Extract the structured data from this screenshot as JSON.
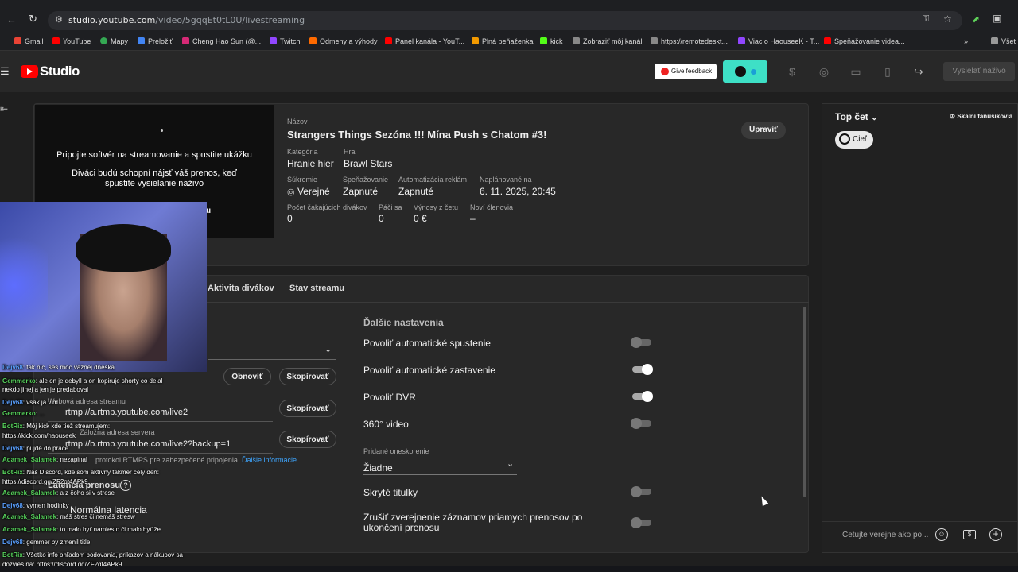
{
  "browser": {
    "url_host": "studio.youtube.com",
    "url_path": "/video/5gqqEt0tL0U/livestreaming",
    "bookmarks": [
      "Gmail",
      "YouTube",
      "Mapy",
      "Preložiť",
      "Cheng Hao Sun (@...",
      "Twitch",
      "Odmeny a výhody",
      "Panel kanála - YouT...",
      "Plná peňaženka",
      "kick",
      "Zobraziť môj kanál",
      "https://remotedeskt...",
      "Viac o HaouseeK - T...",
      "Speňažovanie videa..."
    ],
    "more": "»",
    "other": "Všet"
  },
  "header": {
    "logo": "Studio",
    "feedback": "Give feedback",
    "go_live": "Vysielať naživo"
  },
  "preview": {
    "line1": "Pripojte softvér na streamovanie a spustite ukážku",
    "line2": "Diváci budú schopní nájsť váš prenos, keď spustite vysielanie naživo",
    "partial": "u"
  },
  "stream": {
    "title_label": "Názov",
    "title": "Strangers Things Sezóna !!! Mína Push s Chatom #3!",
    "category_label": "Kategória",
    "category": "Hranie hier",
    "game_label": "Hra",
    "game": "Brawl Stars",
    "privacy_label": "Súkromie",
    "privacy": "Verejné",
    "monet_label": "Speňažovanie",
    "monet": "Zapnuté",
    "ads_label": "Automatizácia reklám",
    "ads": "Zapnuté",
    "sched_label": "Naplánované na",
    "sched": "6. 11. 2025, 20:45",
    "waiting_label": "Počet čakajúcich divákov",
    "waiting": "0",
    "likes_label": "Páči sa",
    "likes": "0",
    "chat_rev_label": "Výnosy z četu",
    "chat_rev": "0 €",
    "members_label": "Noví členovia",
    "members": "–",
    "edit": "Upraviť"
  },
  "tabs": [
    "Aktivita divákov",
    "Stav streamu"
  ],
  "left_settings": {
    "refresh": "Obnoviť",
    "copy": "Skopírovať",
    "url_label": "Webová adresa streamu",
    "url1": "rtmp://a.rtmp.youtube.com/live2",
    "backup_label": "Záložná adresa servera",
    "url2": "rtmp://b.rtmp.youtube.com/live2?backup=1",
    "rtmps": "protokol RTMPS pre zabezpečené pripojenia.",
    "more_info": "Ďalšie informácie",
    "latency_label": "Latencia prenosu",
    "latency": "Normálna latencia"
  },
  "more_settings": {
    "title": "Ďalšie nastavenia",
    "auto_start": "Povoliť automatické spustenie",
    "auto_stop": "Povoliť automatické zastavenie",
    "dvr": "Povoliť DVR",
    "video360": "360° video",
    "delay_label": "Pridané oneskorenie",
    "delay": "Žiadne",
    "captions": "Skryté titulky",
    "unlist": "Zrušiť zverejnenie záznamov priamych prenosov po ukončení prenosu"
  },
  "toggles": {
    "auto_start": 0,
    "auto_stop": 1,
    "dvr": 1,
    "video360": 0,
    "captions": 0,
    "unlist": 0
  },
  "chat": {
    "mode": "Top čet",
    "fans": "Skalní fanúšikovia",
    "goal": "Cieľ",
    "placeholder": "Četujte verejne ako po..."
  },
  "chat_overlay": [
    {
      "user": "Dejv68",
      "text": ": tak nic, ses moc vážnej dneska",
      "cls": "b"
    },
    {
      "user": "Gemmerko",
      "text": ": ale on je debyll a on kopiruje shorty co delal",
      "cls": "g"
    },
    {
      "user": "",
      "text": "nekdo jinej a jen je predaboval",
      "cls": ""
    },
    {
      "user": "Dejv68",
      "text": ": vsak ja vim",
      "cls": "b"
    },
    {
      "user": "Gemmerko",
      "text": ": ...",
      "cls": "g"
    },
    {
      "user": "BotRix",
      "text": ": Môj kick kde tiež streamujem:",
      "cls": "g"
    },
    {
      "user": "",
      "text": "https://kick.com/haouseek",
      "cls": ""
    },
    {
      "user": "Dejv68",
      "text": ": pujde do prace",
      "cls": "b"
    },
    {
      "user": "Adamek_Salamek",
      "text": ": nezapinal",
      "cls": "g"
    },
    {
      "user": "BotRix",
      "text": ": Náš Discord, kde som aktívny takmer celý deň:",
      "cls": "g"
    },
    {
      "user": "",
      "text": "https://discord.gg/ZF2qt4APk9",
      "cls": ""
    },
    {
      "user": "Adamek_Salamek",
      "text": ": a z čoho si v strese",
      "cls": "g"
    },
    {
      "user": "Dejv68",
      "text": ": vymen hodinky",
      "cls": "b"
    },
    {
      "user": "Adamek_Salamek",
      "text": ": máš stres či nemáš stresw",
      "cls": "g"
    },
    {
      "user": "Adamek_Salamek",
      "text": ": to malo byť namiesto či malo byť že",
      "cls": "g"
    },
    {
      "user": "Dejv68",
      "text": ": gemmer by zmenil title",
      "cls": "b"
    },
    {
      "user": "BotRix",
      "text": ": Všetko info ohľadom bodovania, príkazov a nákupov sa",
      "cls": "g"
    },
    {
      "user": "",
      "text": "dozvieš na: https://discord.gg/ZF2qt4APk9",
      "cls": ""
    }
  ]
}
